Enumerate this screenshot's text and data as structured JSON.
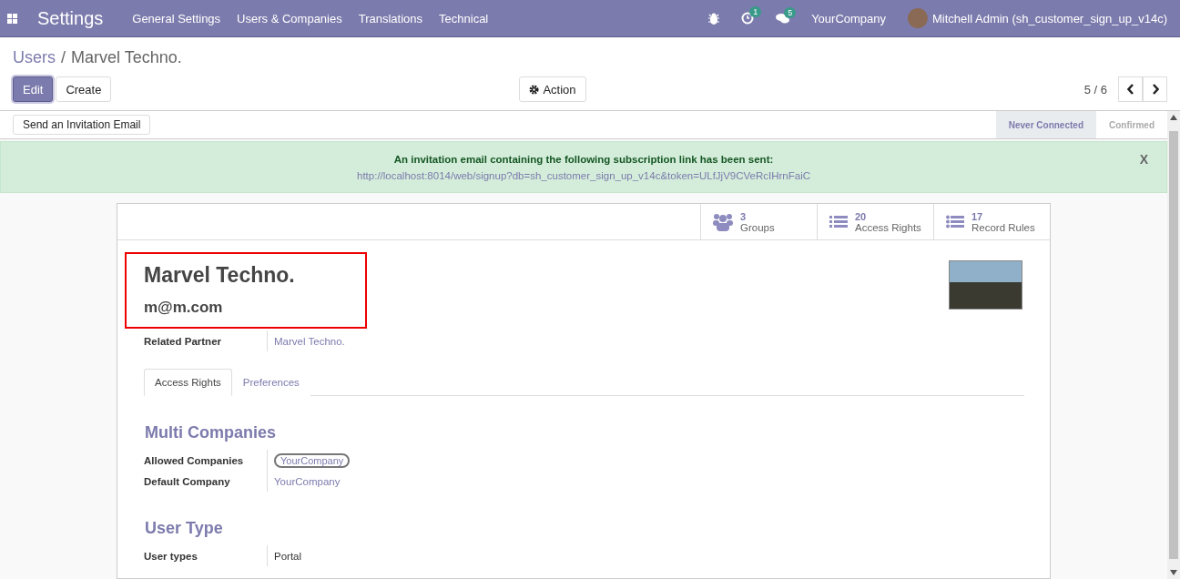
{
  "navbar": {
    "app_title": "Settings",
    "menu": [
      "General Settings",
      "Users & Companies",
      "Translations",
      "Technical"
    ],
    "activity_count": "1",
    "message_count": "5",
    "company": "YourCompany",
    "user": "Mitchell Admin (sh_customer_sign_up_v14c)"
  },
  "breadcrumb": {
    "parent": "Users",
    "separator": "/",
    "current": "Marvel Techno."
  },
  "buttons": {
    "edit": "Edit",
    "create": "Create",
    "action": "Action"
  },
  "pager": "5 / 6",
  "invite_button": "Send an Invitation Email",
  "stages": [
    {
      "label": "Never Connected",
      "selected": true
    },
    {
      "label": "Confirmed",
      "selected": false
    }
  ],
  "alert": {
    "message": "An invitation email containing the following subscription link has been sent:",
    "link": "http://localhost:8014/web/signup?db=sh_customer_sign_up_v14c&token=ULfJjV9CVeRcIHrnFaiC",
    "close": "X"
  },
  "stat_buttons": [
    {
      "kind": "groups",
      "count": "3",
      "label": "Groups"
    },
    {
      "kind": "list",
      "count": "20",
      "label": "Access Rights"
    },
    {
      "kind": "bullets",
      "count": "17",
      "label": "Record Rules"
    }
  ],
  "name": "Marvel Techno.",
  "email": "m@m.com",
  "related_partner": {
    "label": "Related Partner",
    "value": "Marvel Techno."
  },
  "tabs": [
    {
      "label": "Access Rights",
      "selected": true
    },
    {
      "label": "Preferences",
      "selected": false
    }
  ],
  "sections": [
    {
      "title": "Multi Companies",
      "fields": [
        {
          "label": "Allowed Companies",
          "value": "YourCompany",
          "kind": "tag"
        },
        {
          "label": "Default Company",
          "value": "YourCompany",
          "kind": "link"
        }
      ]
    },
    {
      "title": "User Type",
      "fields": [
        {
          "label": "User types",
          "value": "Portal",
          "kind": "text"
        }
      ]
    }
  ]
}
